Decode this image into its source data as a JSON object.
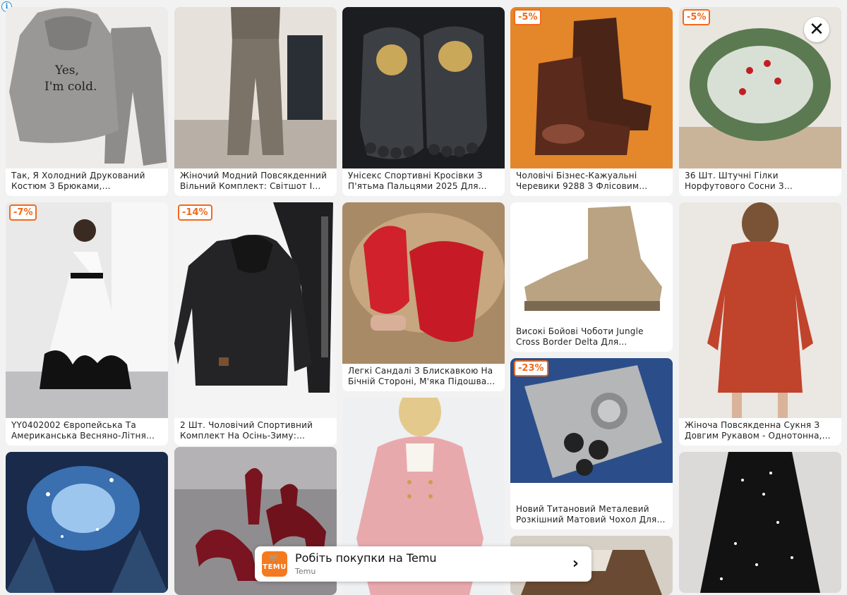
{
  "ad": {
    "info_icon": "i",
    "close_icon": "✕"
  },
  "products": [
    {
      "title": "Так, Я Холодний Друкований Костюм З Брюками,…",
      "badge": ""
    },
    {
      "title": "Жіночий Модний Повсякденний Вільний Комплект: Світшот І…",
      "badge": ""
    },
    {
      "title": "Унісекс Спортивні Кросівки З П'ятьма Пальцями 2025 Для…",
      "badge": ""
    },
    {
      "title": "Чоловічі Бізнес-Кажуальні Черевики 9288 З Флісовим…",
      "badge": "-5%"
    },
    {
      "title": "36 Шт. Штучні Гілки Норфутового Сосни З…",
      "badge": "-5%"
    },
    {
      "title": "YY0402002 Європейська Та Американська Весняно-Літня…",
      "badge": "-7%"
    },
    {
      "title": "2 Шт. Чоловічий Спортивний Комплект На Осінь-Зиму:…",
      "badge": "-14%"
    },
    {
      "title": "Легкі Сандалі З Блискавкою На Бічній Стороні, М'яка Підошва…",
      "badge": ""
    },
    {
      "title": "Високі Бойові Чоботи Jungle Cross Border Delta Для…",
      "badge": ""
    },
    {
      "title": "Жіноча Повсякденна Сукня З Довгим Рукавом - Однотонна,…",
      "badge": ""
    },
    {
      "title": "",
      "badge": ""
    },
    {
      "title": "",
      "badge": ""
    },
    {
      "title": "",
      "badge": ""
    },
    {
      "title": "Новий Титановий Металевий Розкішний Матовий Чохол Для…",
      "badge": "-23%"
    },
    {
      "title": "",
      "badge": ""
    },
    {
      "title": "",
      "badge": ""
    }
  ],
  "image_text": {
    "hoodie_print_line1": "Yes,",
    "hoodie_print_line2": "I'm cold."
  },
  "banner": {
    "logo_text": "TEMU",
    "title": "Робіть покупки на Temu",
    "subtitle": "Temu",
    "arrow": "›"
  },
  "colors": {
    "accent": "#f26a1b",
    "temu_orange": "#f57a1f",
    "background": "#f2f2f2"
  }
}
